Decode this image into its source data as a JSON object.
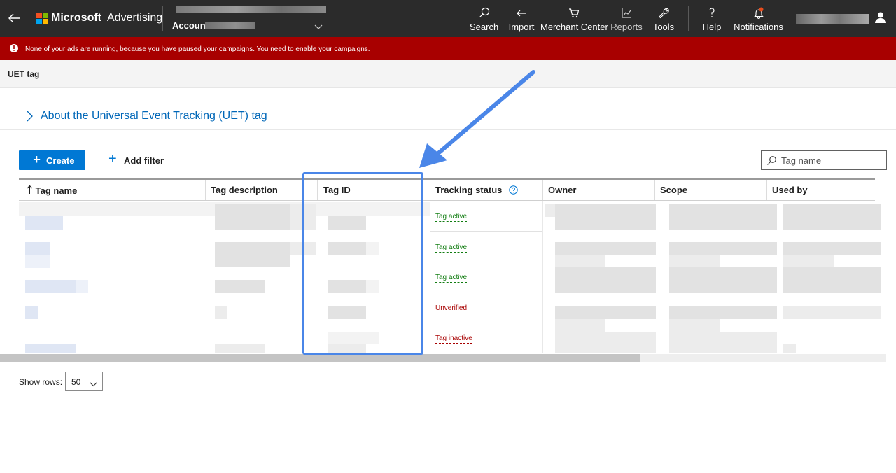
{
  "header": {
    "brand_name": "Microsoft",
    "brand_product": "Advertising",
    "account_label": "Account",
    "nav": [
      {
        "key": "search",
        "label": "Search",
        "icon": "search-icon"
      },
      {
        "key": "import",
        "label": "Import",
        "icon": "import-icon"
      },
      {
        "key": "merchant",
        "label": "Merchant Center",
        "icon": "cart-icon"
      },
      {
        "key": "reports",
        "label": "Reports",
        "icon": "chart-icon"
      },
      {
        "key": "tools",
        "label": "Tools",
        "icon": "wrench-icon"
      },
      {
        "key": "help",
        "label": "Help",
        "icon": "question-icon"
      },
      {
        "key": "notifications",
        "label": "Notifications",
        "icon": "bell-icon"
      }
    ],
    "logo_colors": [
      "#f25022",
      "#7fba00",
      "#00a4ef",
      "#ffb900"
    ]
  },
  "alert": {
    "text": "None of your ads are running, because you have paused your campaigns. You need to enable your campaigns."
  },
  "page": {
    "title": "UET tag",
    "about_link": "About the Universal Event Tracking (UET) tag"
  },
  "toolbar": {
    "create_label": "Create",
    "add_filter_label": "Add filter",
    "search_placeholder": "Tag name"
  },
  "table": {
    "columns": [
      "Tag name",
      "Tag description",
      "Tag ID",
      "Tracking status",
      "Owner",
      "Scope",
      "Used by"
    ],
    "rows": [
      {
        "status": "Tag active",
        "state": "active"
      },
      {
        "status": "Tag active",
        "state": "active"
      },
      {
        "status": "Tag active",
        "state": "active"
      },
      {
        "status": "Unverified",
        "state": "warn"
      },
      {
        "status": "Tag inactive",
        "state": "warn"
      }
    ],
    "status_colors": {
      "active": "#107c10",
      "warn": "#a80000"
    }
  },
  "pagination": {
    "show_rows_label": "Show rows:",
    "rows_value": "50"
  },
  "annotation": {
    "color": "#4a86e8"
  }
}
